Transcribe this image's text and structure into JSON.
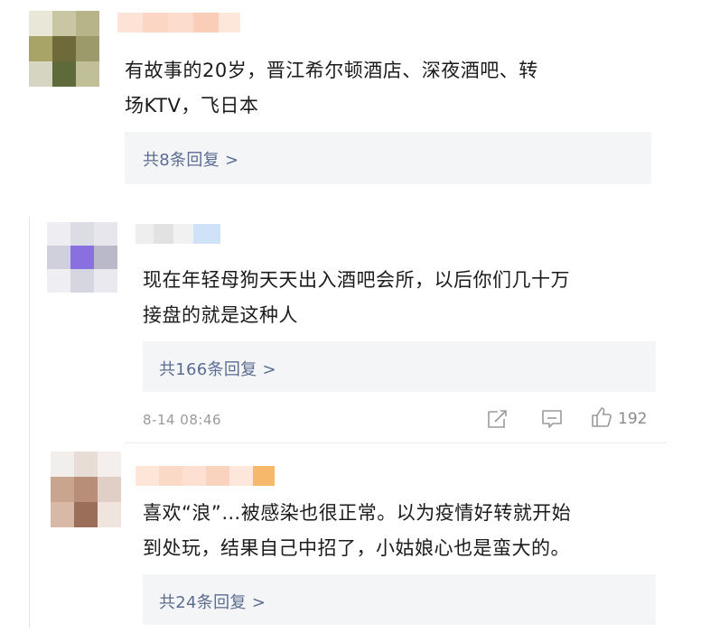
{
  "comments": [
    {
      "text_line1": "有故事的20岁，晋江希尔顿酒店、深夜酒吧、转",
      "text_line2": "场KTV，飞日本",
      "reply_label": "共8条回复 >"
    },
    {
      "text_line1": "现在年轻母狗天天出入酒吧会所，以后你们几十万",
      "text_line2": "接盘的就是这种人",
      "reply_label": "共166条回复 >",
      "time": "8-14 08:46",
      "likes": "192",
      "icons": [
        "share-icon",
        "comment-icon",
        "like-icon"
      ]
    },
    {
      "text_line1": "喜欢“浪”…被感染也很正常。以为疫情好转就开始",
      "text_line2": "到处玩，结果自己中招了，小姑娘心也是蛮大的。",
      "reply_label": "共24条回复 >"
    }
  ],
  "colors": {
    "link": "#5b6c92",
    "reply_bg": "#f4f5f7",
    "meta": "#9a9a9a"
  }
}
